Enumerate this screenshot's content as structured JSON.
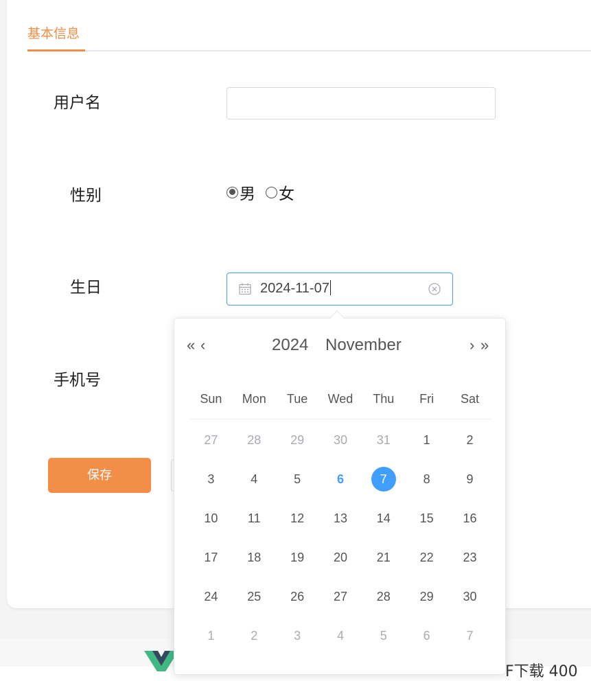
{
  "tabs": {
    "active_label": "基本信息"
  },
  "form": {
    "username_label": "用户名",
    "username_value": "",
    "gender_label": "性别",
    "gender_options": [
      "男",
      "女"
    ],
    "gender_selected": "男",
    "birthday_label": "生日",
    "birthday_value": "2024-11-07",
    "phone_label": "手机号",
    "save_label": "保存"
  },
  "date_picker": {
    "prev_year": "«",
    "prev_month": "‹",
    "next_month": "›",
    "next_year": "»",
    "year": "2024",
    "month": "November",
    "weekdays": [
      "Sun",
      "Mon",
      "Tue",
      "Wed",
      "Thu",
      "Fri",
      "Sat"
    ],
    "weeks": [
      [
        {
          "d": "27",
          "o": 1
        },
        {
          "d": "28",
          "o": 1
        },
        {
          "d": "29",
          "o": 1
        },
        {
          "d": "30",
          "o": 1
        },
        {
          "d": "31",
          "o": 1
        },
        {
          "d": "1"
        },
        {
          "d": "2"
        }
      ],
      [
        {
          "d": "3"
        },
        {
          "d": "4"
        },
        {
          "d": "5"
        },
        {
          "d": "6",
          "today": 1
        },
        {
          "d": "7",
          "sel": 1
        },
        {
          "d": "8"
        },
        {
          "d": "9"
        }
      ],
      [
        {
          "d": "10"
        },
        {
          "d": "11"
        },
        {
          "d": "12"
        },
        {
          "d": "13"
        },
        {
          "d": "14"
        },
        {
          "d": "15"
        },
        {
          "d": "16"
        }
      ],
      [
        {
          "d": "17"
        },
        {
          "d": "18"
        },
        {
          "d": "19"
        },
        {
          "d": "20"
        },
        {
          "d": "21"
        },
        {
          "d": "22"
        },
        {
          "d": "23"
        }
      ],
      [
        {
          "d": "24"
        },
        {
          "d": "25"
        },
        {
          "d": "26"
        },
        {
          "d": "27"
        },
        {
          "d": "28"
        },
        {
          "d": "29"
        },
        {
          "d": "30"
        }
      ],
      [
        {
          "d": "1",
          "o": 1
        },
        {
          "d": "2",
          "o": 1
        },
        {
          "d": "3",
          "o": 1
        },
        {
          "d": "4",
          "o": 1
        },
        {
          "d": "5",
          "o": 1
        },
        {
          "d": "6",
          "o": 1
        },
        {
          "d": "7",
          "o": 1
        }
      ]
    ]
  },
  "footer": {
    "partial_text": "F下载 400"
  },
  "icons": {
    "calendar": "calendar-icon",
    "clear": "circle-close-icon",
    "logo": "vue-logo"
  },
  "colors": {
    "accent": "#f08d47",
    "primary": "#409eff",
    "button": "#f28e48"
  }
}
